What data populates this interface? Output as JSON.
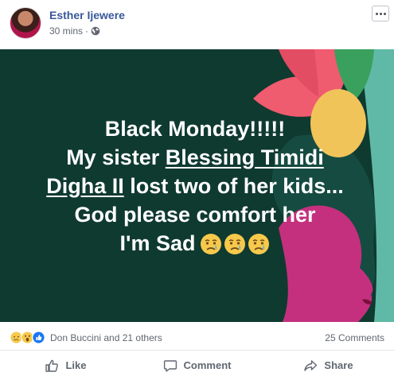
{
  "post": {
    "author": "Esther Ijewere",
    "time": "30 mins",
    "privacy_icon": "globe-icon",
    "more_icon": "more-options-icon"
  },
  "image_text": {
    "line1": "Black Monday!!!!!",
    "line2_prefix": "My sister ",
    "line2_link": "Blessing Timidi",
    "line3_link": "Digha II",
    "line3_suffix": " lost two of her kids...",
    "line4": "God please comfort her",
    "line5": "I'm Sad",
    "emojis": [
      "crying-face",
      "crying-face",
      "crying-face"
    ],
    "colors": {
      "background": "#0f3a30",
      "leaf_pink": "#ef5b6f",
      "fruit_yellow": "#f1c45a",
      "teal": "#5fb9a6",
      "face_magenta": "#c4307e",
      "text": "#ffffff"
    }
  },
  "reactions": {
    "icons": [
      "sad-reaction",
      "wow-reaction",
      "like-reaction"
    ],
    "names": "Don Buccini and 21 others",
    "comments": "25 Comments"
  },
  "actions": {
    "like": "Like",
    "comment": "Comment",
    "share": "Share"
  }
}
